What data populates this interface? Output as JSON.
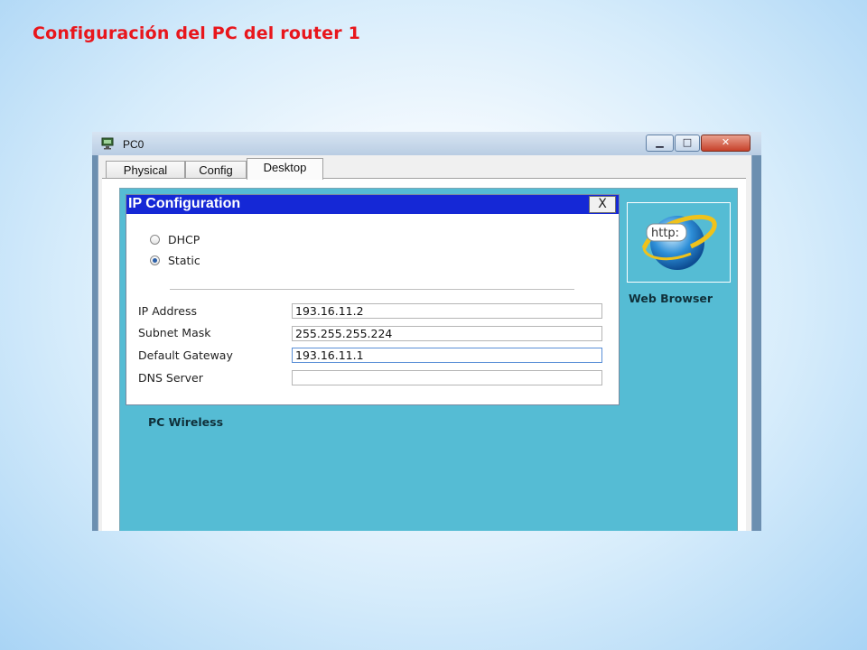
{
  "slide": {
    "title": "Configuración del PC del router 1"
  },
  "window": {
    "title": "PC0",
    "icon": "pc-icon",
    "buttons": {
      "minimize": "▁",
      "maximize": "□",
      "close": "✕"
    },
    "tabs": [
      {
        "label": "Physical",
        "active": false
      },
      {
        "label": "Config",
        "active": false
      },
      {
        "label": "Desktop",
        "active": true
      }
    ]
  },
  "desktop": {
    "apps": [
      {
        "label": "Web Browser",
        "icon": "web-browser-icon",
        "icon_text": "http:"
      },
      {
        "label": "PC Wireless",
        "icon": "pc-wireless-icon"
      }
    ],
    "background_color": "#55bcd4"
  },
  "ip_config": {
    "title": "IP Configuration",
    "close_label": "X",
    "mode_options": [
      {
        "label": "DHCP",
        "selected": false
      },
      {
        "label": "Static",
        "selected": true
      }
    ],
    "fields": [
      {
        "label": "IP Address",
        "value": "193.16.11.2"
      },
      {
        "label": "Subnet Mask",
        "value": "255.255.255.224"
      },
      {
        "label": "Default Gateway",
        "value": "193.16.11.1"
      },
      {
        "label": "DNS Server",
        "value": ""
      }
    ],
    "titlebar_color": "#1528d6"
  }
}
